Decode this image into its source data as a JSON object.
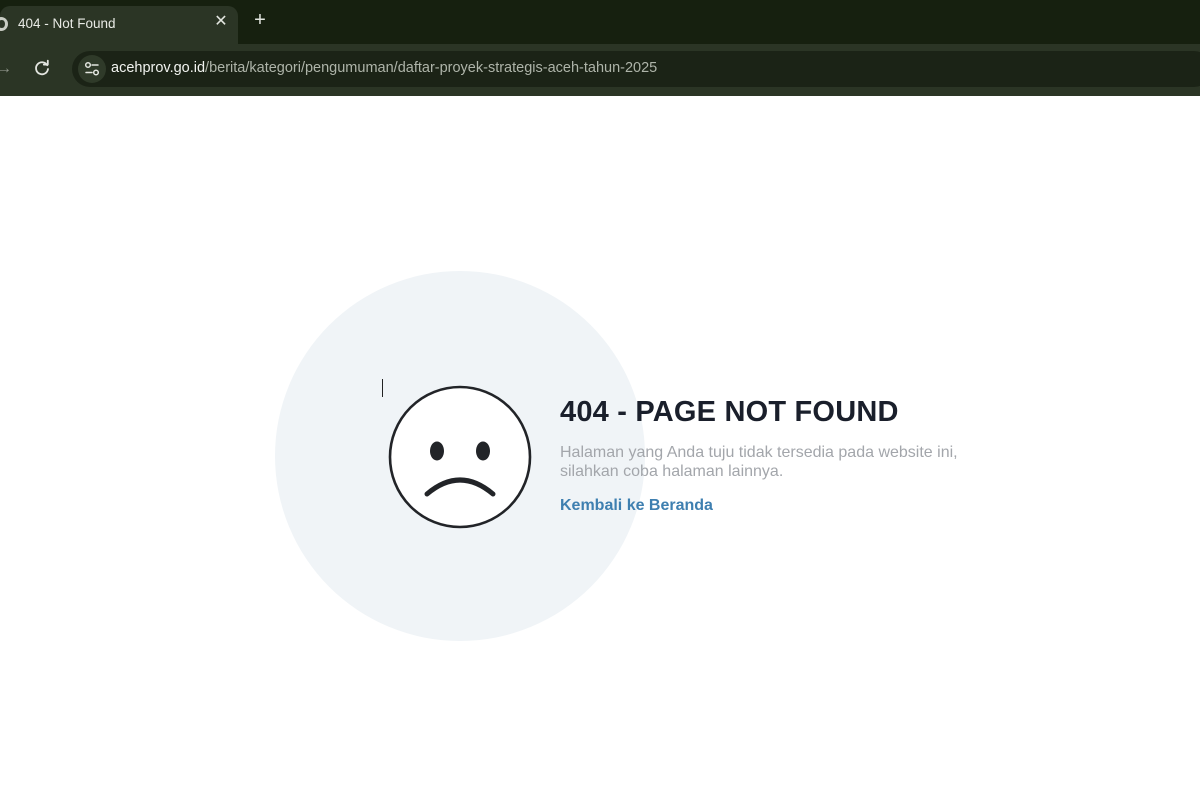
{
  "browser": {
    "tab": {
      "title": "404 - Not Found",
      "close_glyph": "✕",
      "favicon_icon": "globe-icon"
    },
    "new_tab_glyph": "+",
    "toolbar": {
      "forward_glyph": "→",
      "reload_icon": "reload-icon",
      "site_info_icon": "tune-icon"
    },
    "address_bar": {
      "domain": "acehprov.go.id",
      "path": "/berita/kategori/pengumuman/daftar-proyek-strategis-aceh-tahun-2025"
    }
  },
  "page": {
    "illustration_icon": "sad-face-icon",
    "heading": "404 - PAGE NOT FOUND",
    "description": "Halaman yang Anda tuju tidak tersedia pada website ini, silahkan coba halaman lainnya.",
    "home_link": "Kembali ke Beranda"
  },
  "colors": {
    "chrome_dark": "#16200f",
    "toolbar": "#2b3525",
    "circle_bg": "#f0f4f7",
    "heading": "#1a1f2b",
    "description": "#a3a6ab",
    "link": "#3e7fb0"
  }
}
